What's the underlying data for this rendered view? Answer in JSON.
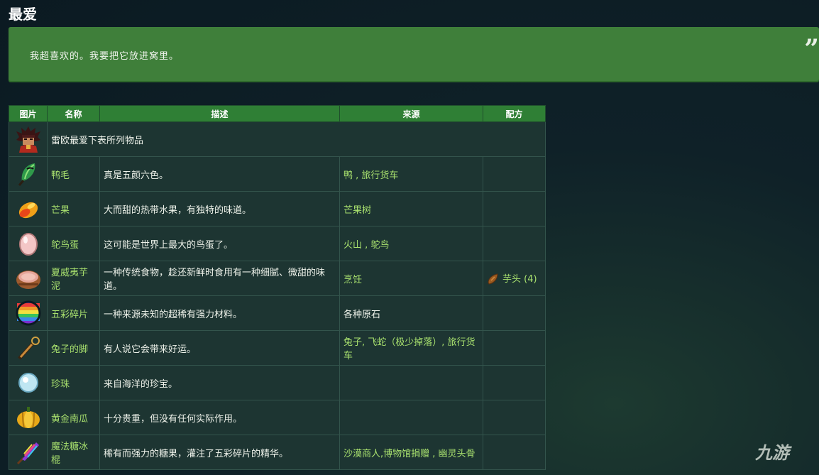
{
  "heading": "最爱",
  "quote": {
    "text": "我超喜欢的。我要把它放进窝里。",
    "mark": "”"
  },
  "table": {
    "headers": {
      "image": "图片",
      "name": "名称",
      "desc": "描述",
      "source": "来源",
      "recipe": "配方"
    },
    "intro": "雷欧最爱下表所列物品",
    "rows": [
      {
        "name": "鸭毛",
        "desc": "真是五颜六色。",
        "source": "鸭 , 旅行货车",
        "icon": "duck-feather-icon"
      },
      {
        "name": "芒果",
        "desc": "大而甜的热带水果，有独特的味道。",
        "source": "芒果树",
        "icon": "mango-icon"
      },
      {
        "name": "鸵鸟蛋",
        "desc": "这可能是世界上最大的鸟蛋了。",
        "source": "火山 , 鸵鸟",
        "icon": "ostrich-egg-icon"
      },
      {
        "name": "夏威夷芋泥",
        "desc": "一种传统食物，趁还新鲜时食用有一种细腻、微甜的味道。",
        "source": "烹饪",
        "recipe": "芋头 (4)",
        "icon": "poi-icon"
      },
      {
        "name": "五彩碎片",
        "desc": "一种来源未知的超稀有强力材料。",
        "source": "各种原石",
        "icon": "prismatic-shard-icon"
      },
      {
        "name": "兔子的脚",
        "desc": "有人说它会带来好运。",
        "source": "兔子, 飞蛇（极少掉落）, 旅行货车",
        "icon": "rabbit-foot-icon"
      },
      {
        "name": "珍珠",
        "desc": "来自海洋的珍宝。",
        "source": "",
        "icon": "pearl-icon"
      },
      {
        "name": "黄金南瓜",
        "desc": "十分贵重，但没有任何实际作用。",
        "source": "",
        "icon": "golden-pumpkin-icon"
      },
      {
        "name": "魔法糖冰棍",
        "desc": "稀有而强力的糖果，灌注了五彩碎片的精华。",
        "source": "沙漠商人,博物馆捐赠 , 幽灵头骨",
        "icon": "magic-rock-candy-icon"
      }
    ]
  },
  "watermark": "九游"
}
